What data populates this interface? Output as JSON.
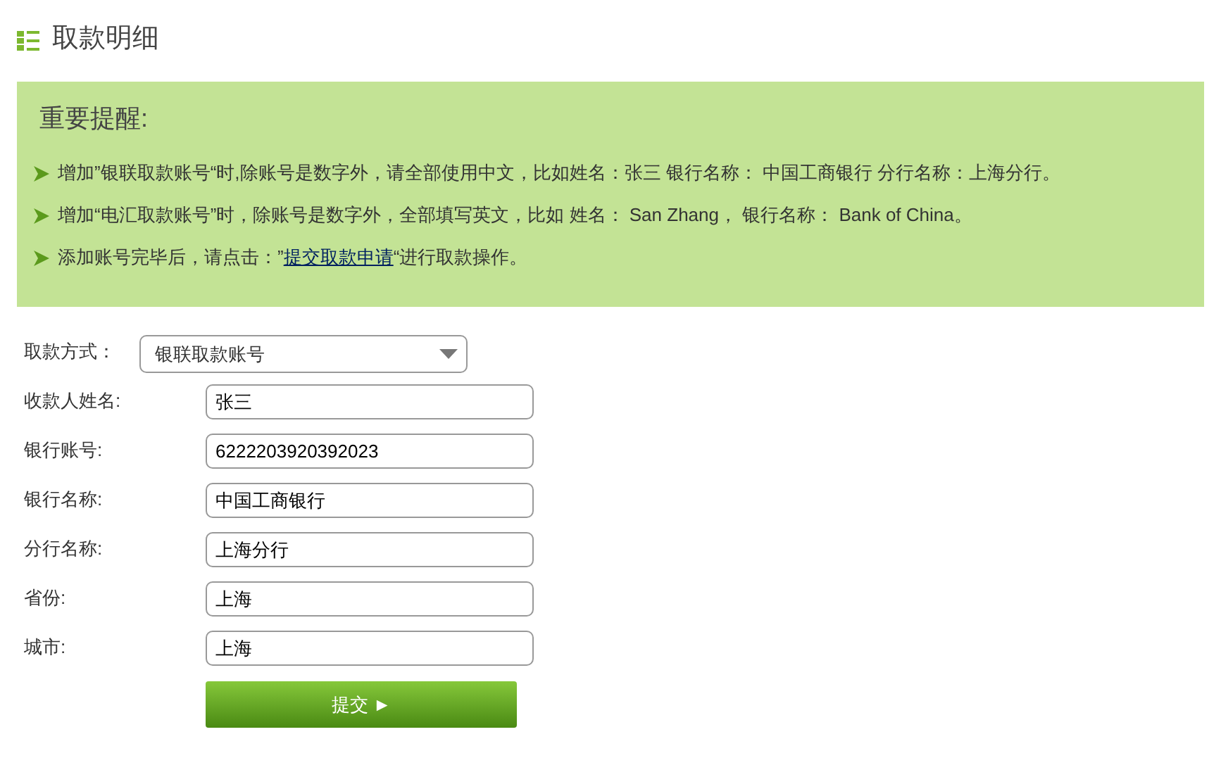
{
  "page_title": "取款明细",
  "notice": {
    "title": "重要提醒:",
    "tips": [
      {
        "parts": [
          {
            "kind": "text",
            "text": "增加”银联取款账号“时,除账号是数字外，请全部使用中文，比如姓名：张三 银行名称： 中国工商银行 分行名称：上海分行。"
          }
        ]
      },
      {
        "parts": [
          {
            "kind": "text",
            "text": "增加“电汇取款账号”时，除账号是数字外，全部填写英文，比如 姓名： San Zhang， 银行名称： Bank of China。"
          }
        ]
      },
      {
        "parts": [
          {
            "kind": "text",
            "text": "添加账号完毕后，请点击：”"
          },
          {
            "kind": "link",
            "text": "提交取款申请"
          },
          {
            "kind": "text",
            "text": "“进行取款操作。"
          }
        ]
      }
    ]
  },
  "form": {
    "method": {
      "label": "取款方式：",
      "value": "银联取款账号"
    },
    "fields": [
      {
        "label": "收款人姓名:",
        "value": "张三"
      },
      {
        "label": "银行账号:",
        "value": "6222203920392023"
      },
      {
        "label": "银行名称:",
        "value": "中国工商银行"
      },
      {
        "label": "分行名称:",
        "value": "上海分行"
      },
      {
        "label": "省份:",
        "value": "上海"
      },
      {
        "label": "城市:",
        "value": "上海"
      }
    ],
    "submit": "提交 ►"
  }
}
